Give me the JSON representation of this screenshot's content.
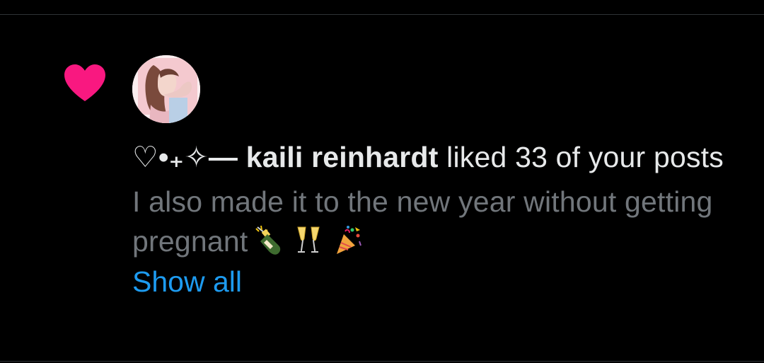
{
  "notification": {
    "icon": "heart-icon",
    "icon_color": "#f91880",
    "avatar": "avatar",
    "user_name": "♡•₊✧— kaili reinhardt",
    "action_text": " liked 33 of your posts",
    "post_preview": "I also made it to the new year without getting pregnant",
    "preview_emojis": [
      "champagne-bottle-icon",
      "clinking-glasses-icon",
      "party-popper-icon"
    ],
    "show_all_label": "Show all",
    "link_color": "#1d9bf0",
    "text_color": "#e7e9ea",
    "muted_color": "#71767b"
  }
}
